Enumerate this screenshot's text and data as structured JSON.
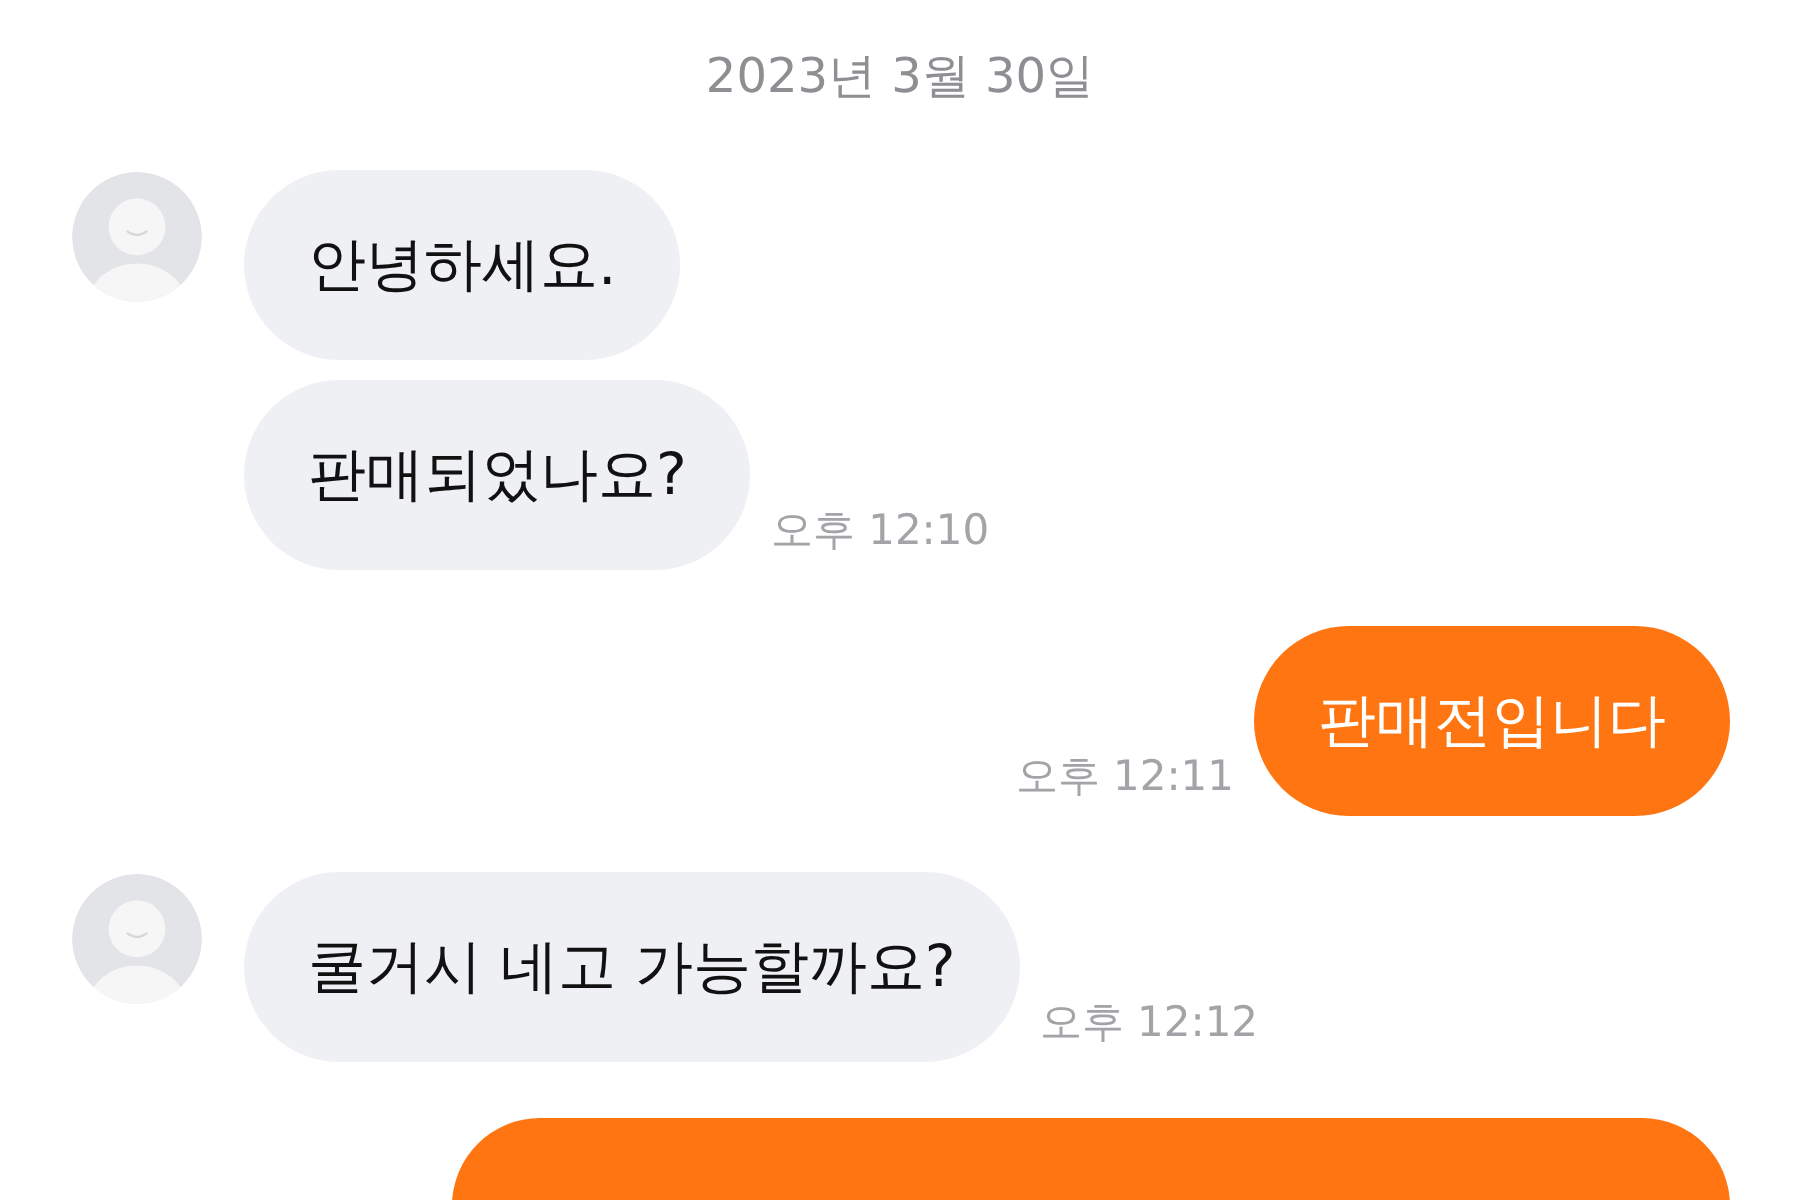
{
  "date": "2023년 3월 30일",
  "groups": [
    {
      "kind": "incoming",
      "messages": [
        {
          "kind": "text",
          "text": "안녕하세요."
        },
        {
          "kind": "text",
          "text": "판매되었나요?"
        }
      ],
      "time": "오후 12:10"
    },
    {
      "kind": "outgoing",
      "messages": [
        {
          "kind": "text",
          "text": "판매전입니다"
        }
      ],
      "time": "오후 12:11"
    },
    {
      "kind": "incoming",
      "messages": [
        {
          "kind": "text",
          "text": "쿨거시 네고 가능할까요?"
        }
      ],
      "time": "오후 12:12"
    },
    {
      "kind": "outgoing",
      "messages": [
        {
          "kind": "cut"
        }
      ]
    }
  ]
}
